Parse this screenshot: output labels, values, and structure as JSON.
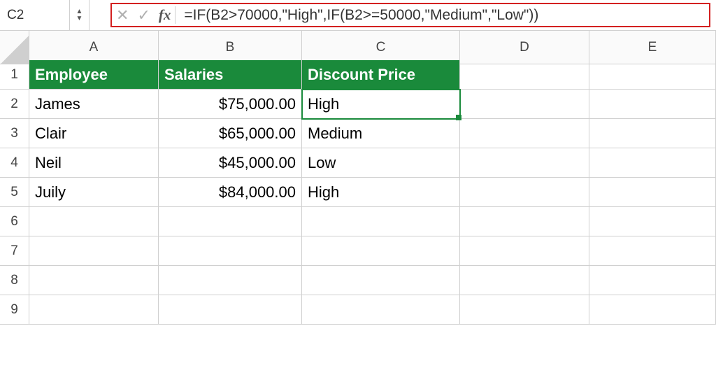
{
  "nameBox": "C2",
  "formula": "=IF(B2>70000,\"High\",IF(B2>=50000,\"Medium\",\"Low\"))",
  "columns": [
    "A",
    "B",
    "C",
    "D",
    "E"
  ],
  "rowNumbers": [
    "1",
    "2",
    "3",
    "4",
    "5",
    "6",
    "7",
    "8",
    "9"
  ],
  "headers": {
    "A": "Employee",
    "B": "Salaries",
    "C": "Discount Price"
  },
  "data": [
    {
      "employee": "James",
      "salary": "$75,000.00",
      "discount": "High"
    },
    {
      "employee": "Clair",
      "salary": "$65,000.00",
      "discount": "Medium"
    },
    {
      "employee": "Neil",
      "salary": "$45,000.00",
      "discount": "Low"
    },
    {
      "employee": "Juily",
      "salary": "$84,000.00",
      "discount": "High"
    }
  ],
  "icons": {
    "cancel": "✕",
    "enter": "✓",
    "up": "▲",
    "down": "▼",
    "fx": "fx"
  }
}
